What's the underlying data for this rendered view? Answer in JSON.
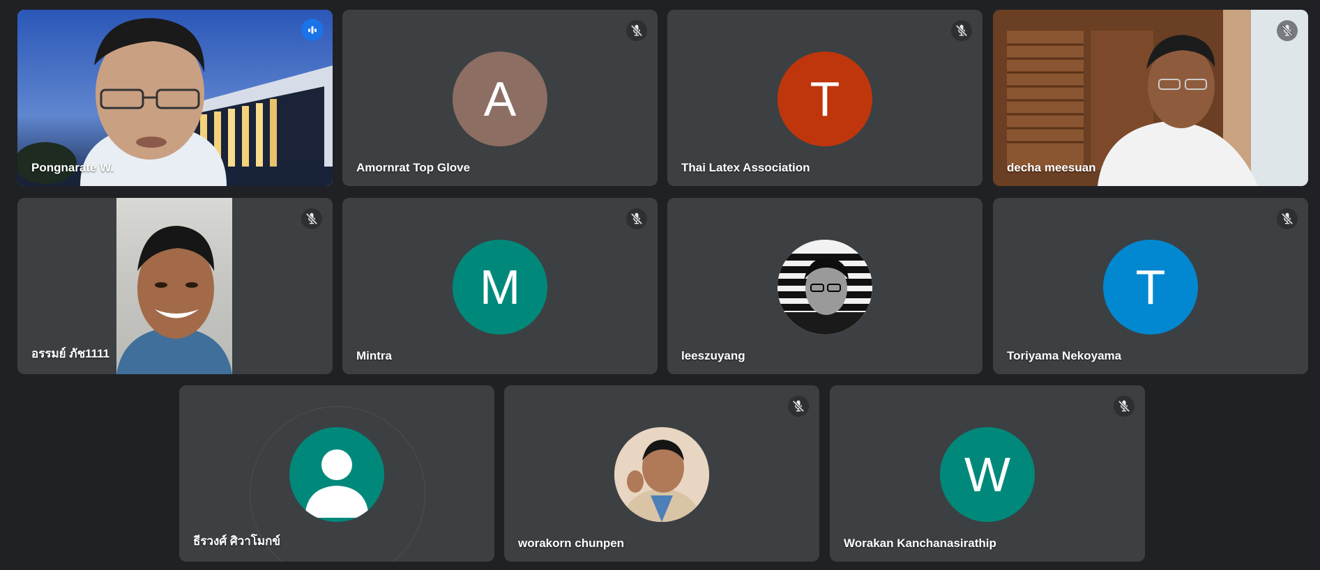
{
  "participants": [
    {
      "name": "Pongnarate W.",
      "state": "speaking",
      "speaking_icon": "audio-bars-icon"
    },
    {
      "name": "Amornrat Top Glove",
      "initial": "A",
      "avatar_color": "#8d6e63",
      "muted": true
    },
    {
      "name": "Thai Latex Association",
      "initial": "T",
      "avatar_color": "#bf360c",
      "muted": true
    },
    {
      "name": "decha meesuan",
      "muted": true
    },
    {
      "name": "อรรมย์ ภัช1111",
      "muted": true
    },
    {
      "name": "Mintra",
      "initial": "M",
      "avatar_color": "#00897b",
      "muted": true
    },
    {
      "name": "leeszuyang",
      "muted": true
    },
    {
      "name": "Toriyama Nekoyama",
      "initial": "T",
      "avatar_color": "#0288d1",
      "muted": true
    },
    {
      "name": "ธีรวงศ์ ศิวาโมกข์",
      "avatar_color": "#00897b",
      "avatar_icon": "person-icon"
    },
    {
      "name": "worakorn chunpen",
      "muted": true
    },
    {
      "name": "Worakan Kanchanasirathip",
      "initial": "W",
      "avatar_color": "#00897b",
      "muted": true
    }
  ],
  "colors": {
    "background": "#202124",
    "tile": "#3c4043",
    "active_outline": "#8ab4f8",
    "speaking_badge": "#1a73e8"
  },
  "icons": {
    "mute": "mic-off-icon",
    "speaking": "audio-bars-icon",
    "placeholder": "person-icon"
  }
}
